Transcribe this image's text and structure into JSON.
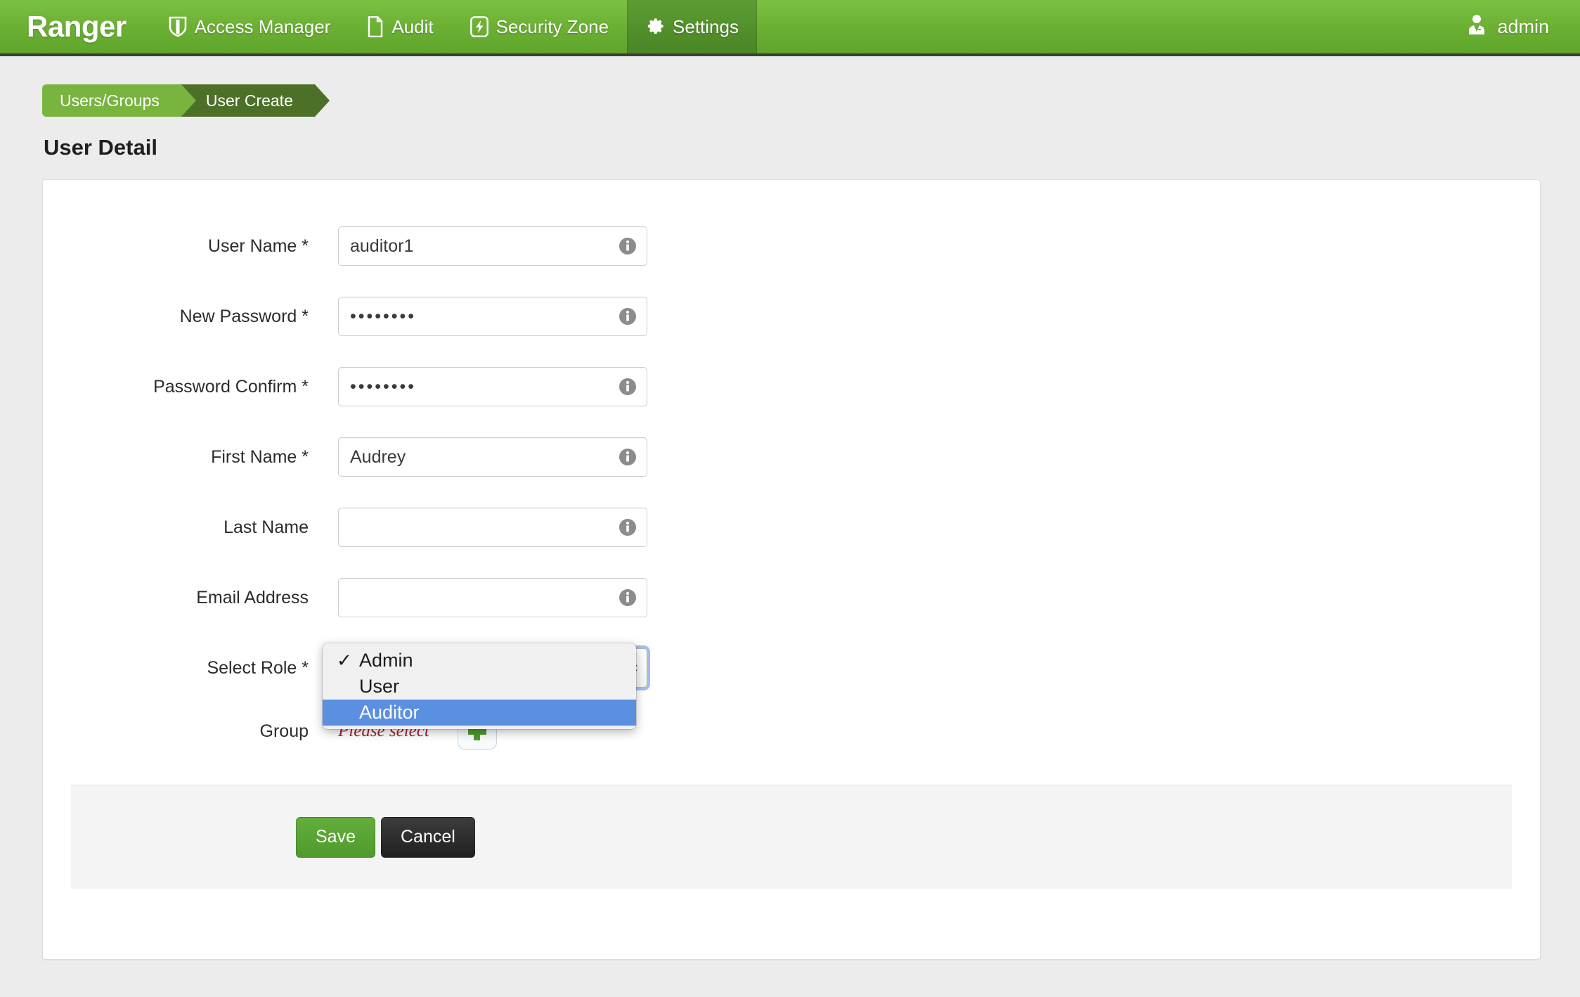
{
  "app": {
    "brand": "Ranger",
    "nav": [
      {
        "label": "Access Manager",
        "icon": "shield-icon",
        "active": false
      },
      {
        "label": "Audit",
        "icon": "file-icon",
        "active": false
      },
      {
        "label": "Security Zone",
        "icon": "bolt-icon",
        "active": false
      },
      {
        "label": "Settings",
        "icon": "gear-icon",
        "active": true
      }
    ],
    "user": {
      "name": "admin",
      "icon": "user-avatar-icon"
    },
    "accent_green": "#6cb134",
    "active_green": "#53912c"
  },
  "breadcrumb": {
    "items": [
      {
        "label": "Users/Groups"
      },
      {
        "label": "User Create"
      }
    ]
  },
  "page": {
    "title": "User Detail"
  },
  "form": {
    "fields": [
      {
        "label": "User Name *",
        "value": "auditor1",
        "type": "text",
        "name": "user-name"
      },
      {
        "label": "New Password *",
        "value": "••••••••",
        "type": "password",
        "name": "new-password"
      },
      {
        "label": "Password Confirm *",
        "value": "••••••••",
        "type": "password",
        "name": "password-confirm"
      },
      {
        "label": "First Name *",
        "value": "Audrey",
        "type": "text",
        "name": "first-name"
      },
      {
        "label": "Last Name",
        "value": "",
        "type": "text",
        "name": "last-name"
      },
      {
        "label": "Email Address",
        "value": "",
        "type": "text",
        "name": "email-address"
      }
    ],
    "select_role": {
      "label": "Select Role *",
      "selected": "Admin",
      "highlighted": "Auditor",
      "options": [
        {
          "label": "Admin",
          "checked": true,
          "highlighted": false
        },
        {
          "label": "User",
          "checked": false,
          "highlighted": false
        },
        {
          "label": "Auditor",
          "checked": false,
          "highlighted": true
        }
      ]
    },
    "group": {
      "label": "Group",
      "value": "Please select",
      "add_icon": "plus-icon"
    }
  },
  "actions": {
    "save_label": "Save",
    "cancel_label": "Cancel"
  }
}
